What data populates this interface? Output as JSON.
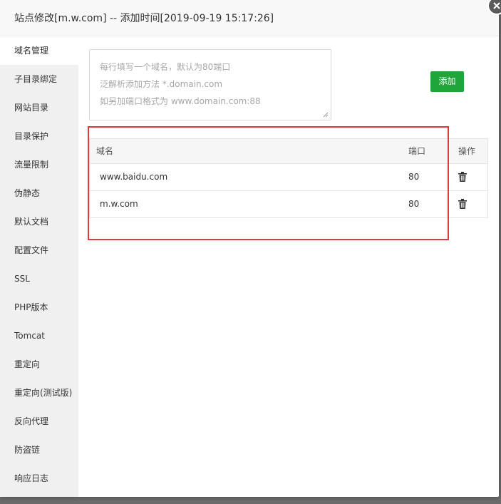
{
  "dialog": {
    "title": "站点修改[m.w.com] -- 添加时间[2019-09-19 15:17:26]"
  },
  "sidebar": {
    "items": [
      {
        "label": "域名管理",
        "active": true
      },
      {
        "label": "子目录绑定"
      },
      {
        "label": "网站目录"
      },
      {
        "label": "目录保护"
      },
      {
        "label": "流量限制"
      },
      {
        "label": "伪静态"
      },
      {
        "label": "默认文档"
      },
      {
        "label": "配置文件"
      },
      {
        "label": "SSL"
      },
      {
        "label": "PHP版本"
      },
      {
        "label": "Tomcat"
      },
      {
        "label": "重定向"
      },
      {
        "label": "重定向(测试版)"
      },
      {
        "label": "反向代理"
      },
      {
        "label": "防盗链"
      },
      {
        "label": "响应日志"
      }
    ]
  },
  "domain_input": {
    "placeholder_lines": [
      "每行填写一个域名，默认为80端口",
      "泛解析添加方法 *.domain.com",
      "如另加端口格式为 www.domain.com:88"
    ]
  },
  "add_button": {
    "label": "添加"
  },
  "table": {
    "headers": {
      "domain": "域名",
      "port": "端口",
      "action": "操作"
    },
    "rows": [
      {
        "domain": "www.baidu.com",
        "port": "80",
        "action_icon": "trash-icon"
      },
      {
        "domain": "m.w.com",
        "port": "80",
        "action_icon": "trash-icon"
      }
    ]
  },
  "colors": {
    "accent": "#20a53a",
    "highlight": "#e23a3a"
  }
}
